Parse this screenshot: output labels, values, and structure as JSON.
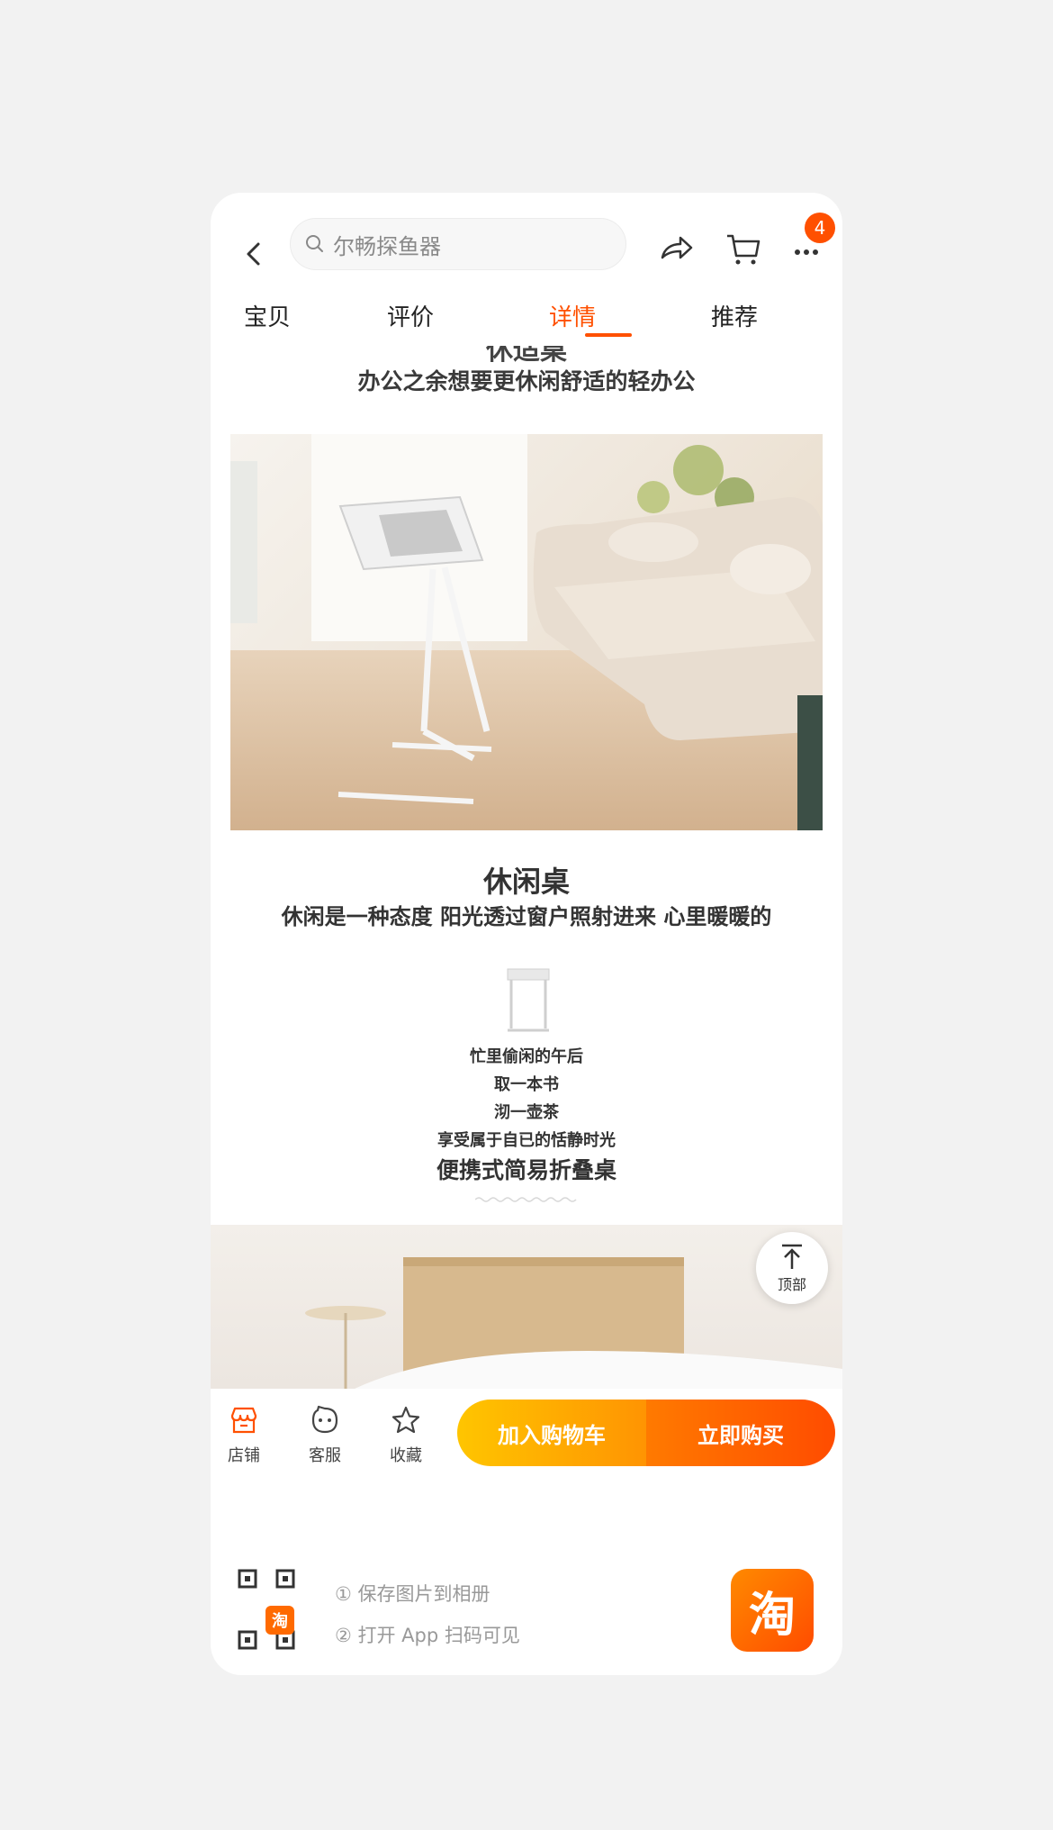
{
  "header": {
    "search_placeholder": "尔畅探鱼器",
    "cart_badge": "4"
  },
  "tabs": [
    {
      "label": "宝贝"
    },
    {
      "label": "评价"
    },
    {
      "label": "详情",
      "active": true
    },
    {
      "label": "推荐"
    }
  ],
  "detail": {
    "cut_title": "休适桌",
    "subtitle1": "办公之余想要更休闲舒适的轻办公",
    "heading2": "休闲桌",
    "heading2_sub": "休闲是一种态度 阳光透过窗户照射进来 心里暖暖的",
    "poem": [
      "忙里偷闲的午后",
      "取一本书",
      "沏一壶茶",
      "享受属于自已的恬静时光"
    ],
    "heading3": "便携式简易折叠桌"
  },
  "back_to_top": {
    "label": "顶部"
  },
  "bottom_bar": {
    "shop": "店铺",
    "service": "客服",
    "favorite": "收藏",
    "add_to_cart": "加入购物车",
    "buy_now": "立即购买"
  },
  "footer": {
    "step1": "① 保存图片到相册",
    "step2": "② 打开 App 扫码可见",
    "qr_badge": "淘",
    "logo_text": "淘"
  },
  "colors": {
    "accent": "#ff5000",
    "cart_gradient_start": "#ffc500",
    "buy_gradient_end": "#ff4c00"
  }
}
